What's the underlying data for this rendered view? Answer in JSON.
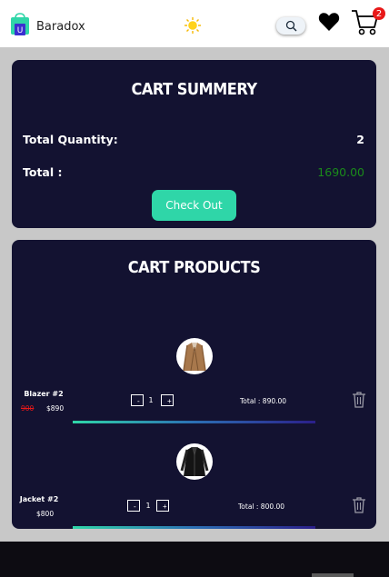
{
  "header": {
    "brand": "Baradox",
    "logo_letter": "U",
    "cart_count": "2",
    "icons": [
      "shopping-bag-logo",
      "sun-icon",
      "search-icon",
      "heart-icon",
      "cart-icon"
    ]
  },
  "summary": {
    "title": "CART SUMMERY",
    "quantity_label": "Total Quantity:",
    "quantity_value": "2",
    "total_label": "Total :",
    "total_value": "1690.00",
    "checkout_label": "Check Out"
  },
  "products": {
    "title": "CART PRODUCTS",
    "items": [
      {
        "name": "Blazer #2",
        "old_price": "900",
        "price": "$890",
        "minus": "-",
        "quantity": "1",
        "plus": "+",
        "total": "Total : 890.00"
      },
      {
        "name": "Jacket #2",
        "price": "$800",
        "minus": "-",
        "quantity": "1",
        "plus": "+",
        "total": "Total : 800.00"
      }
    ]
  },
  "colors": {
    "panel": "#131231",
    "accent": "#2fd6a8",
    "total_value": "#1a8a1a",
    "badge": "#e81919"
  }
}
